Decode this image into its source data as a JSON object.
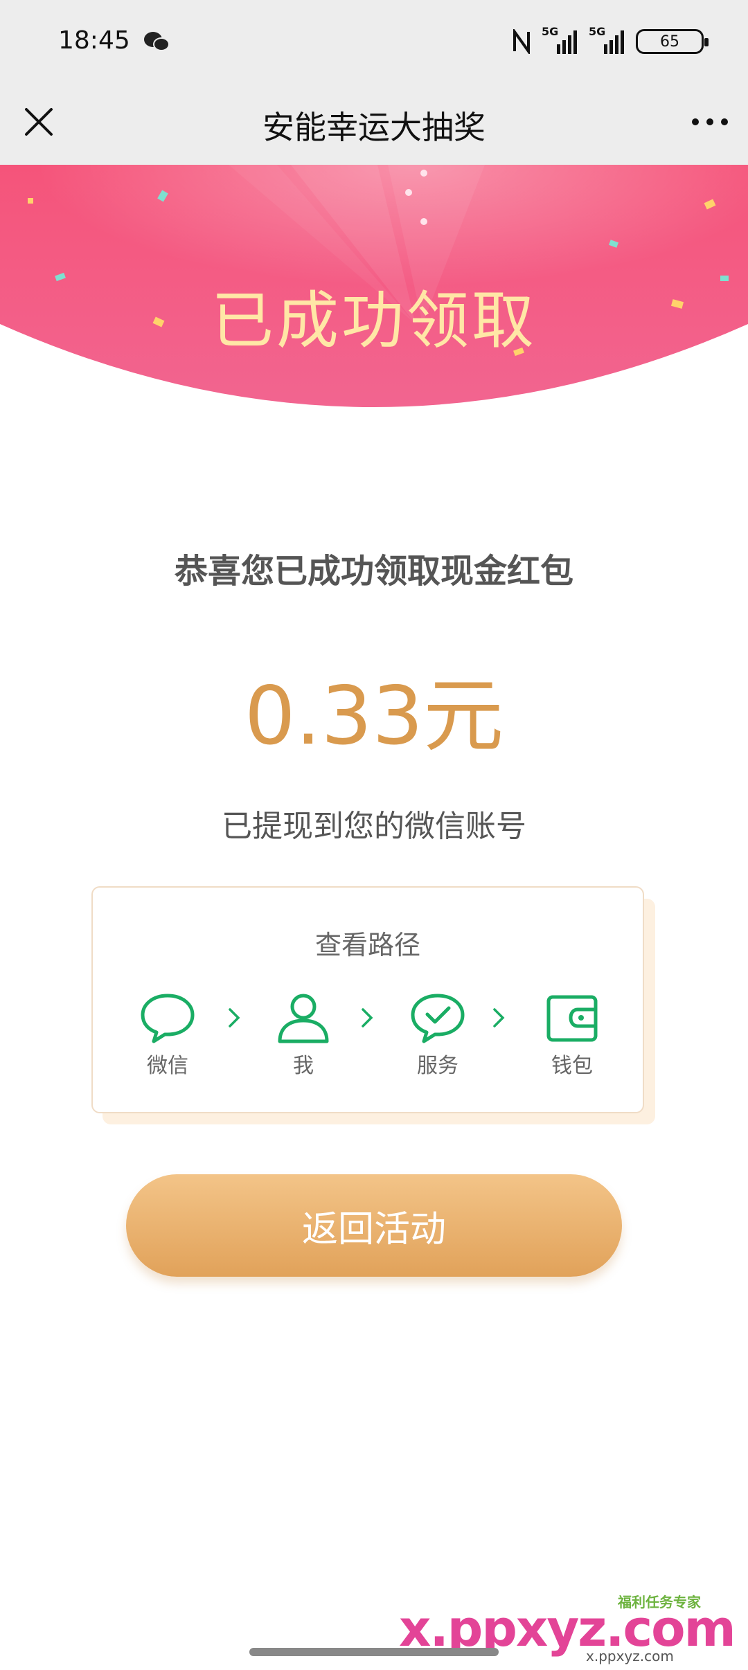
{
  "status_bar": {
    "time": "18:45",
    "signal_1": "5G",
    "signal_2": "5G",
    "battery": "65"
  },
  "nav": {
    "title": "安能幸运大抽奖"
  },
  "banner": {
    "title": "已成功领取",
    "colors": {
      "top": "#f5547a",
      "bottom": "#f26590",
      "title": "#ffe7a6"
    }
  },
  "result": {
    "headline": "恭喜您已成功领取现金红包",
    "amount": "0.33元",
    "note": "已提现到您的微信账号"
  },
  "path_card": {
    "title": "查看路径",
    "steps": [
      {
        "label": "微信",
        "icon": "chat-bubble-icon"
      },
      {
        "label": "我",
        "icon": "person-icon"
      },
      {
        "label": "服务",
        "icon": "check-bubble-icon"
      },
      {
        "label": "钱包",
        "icon": "wallet-icon"
      }
    ],
    "icon_color": "#1aad64"
  },
  "cta": {
    "label": "返回活动"
  },
  "watermark": {
    "text": "x.ppxyz.com",
    "badge": "福利任务专家",
    "subtext": "x.ppxyz.com"
  }
}
